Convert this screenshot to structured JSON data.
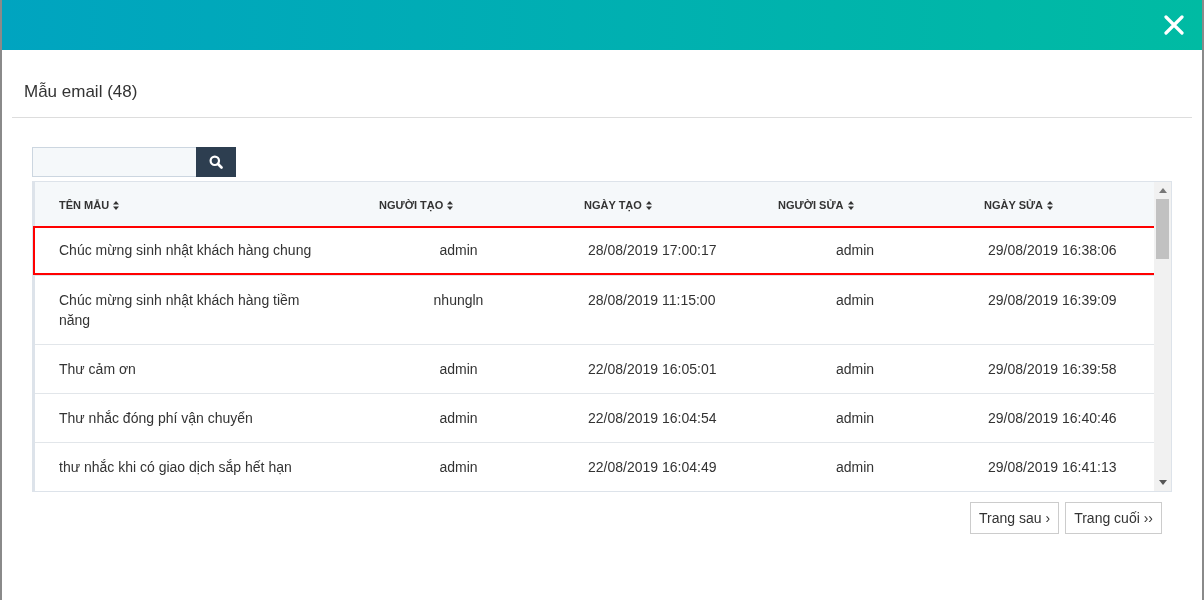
{
  "dialog": {
    "title": "Mẫu email (48)"
  },
  "table": {
    "columns": [
      "TÊN MẪU",
      "NGƯỜI TẠO",
      "NGÀY TẠO",
      "NGƯỜI SỬA",
      "NGÀY SỬA"
    ],
    "rows": [
      {
        "selected": true,
        "cells": [
          "Chúc mừng sinh nhật khách hàng chung",
          "admin",
          "28/08/2019 17:00:17",
          "admin",
          "29/08/2019 16:38:06"
        ]
      },
      {
        "selected": false,
        "cells": [
          "Chúc mừng sinh nhật khách hàng tiềm năng",
          "nhungln",
          "28/08/2019 11:15:00",
          "admin",
          "29/08/2019 16:39:09"
        ]
      },
      {
        "selected": false,
        "cells": [
          "Thư cảm ơn",
          "admin",
          "22/08/2019 16:05:01",
          "admin",
          "29/08/2019 16:39:58"
        ]
      },
      {
        "selected": false,
        "cells": [
          "Thư nhắc đóng phí vận chuyển",
          "admin",
          "22/08/2019 16:04:54",
          "admin",
          "29/08/2019 16:40:46"
        ]
      },
      {
        "selected": false,
        "cells": [
          "thư nhắc khi có giao dịch sắp hết hạn",
          "admin",
          "22/08/2019 16:04:49",
          "admin",
          "29/08/2019 16:41:13"
        ]
      }
    ]
  },
  "pagination": [
    "Trang sau ›",
    "Trang cuối ››"
  ]
}
